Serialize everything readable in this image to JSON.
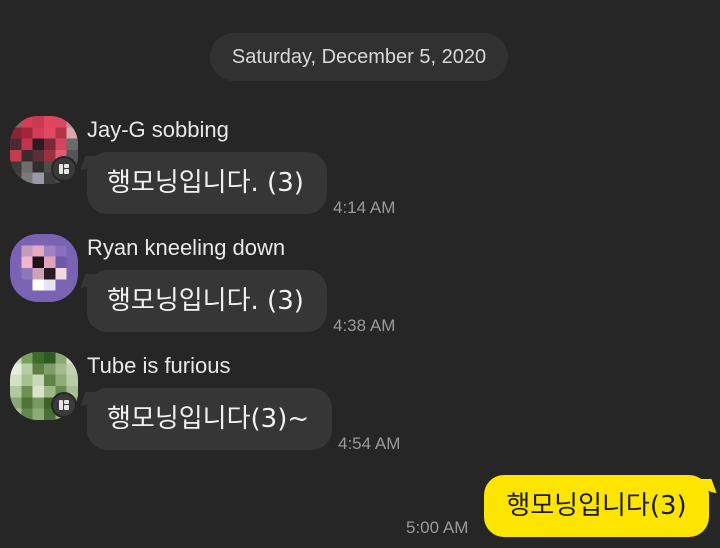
{
  "date_divider": "Saturday, December 5, 2020",
  "messages": [
    {
      "sender": "Jay-G sobbing",
      "text": "행모닝입니다. (3)",
      "time": "4:14 AM"
    },
    {
      "sender": "Ryan kneeling down",
      "text": "행모닝입니다. (3)",
      "time": "4:38 AM"
    },
    {
      "sender": "Tube is furious",
      "text": "행모닝입니다(3)~",
      "time": "4:54 AM"
    }
  ],
  "my_message": {
    "text": "행모닝입니다(3)",
    "time": "5:00 AM"
  },
  "colors": {
    "background": "#262626",
    "incoming_bubble": "#363636",
    "outgoing_bubble": "#fee500"
  }
}
